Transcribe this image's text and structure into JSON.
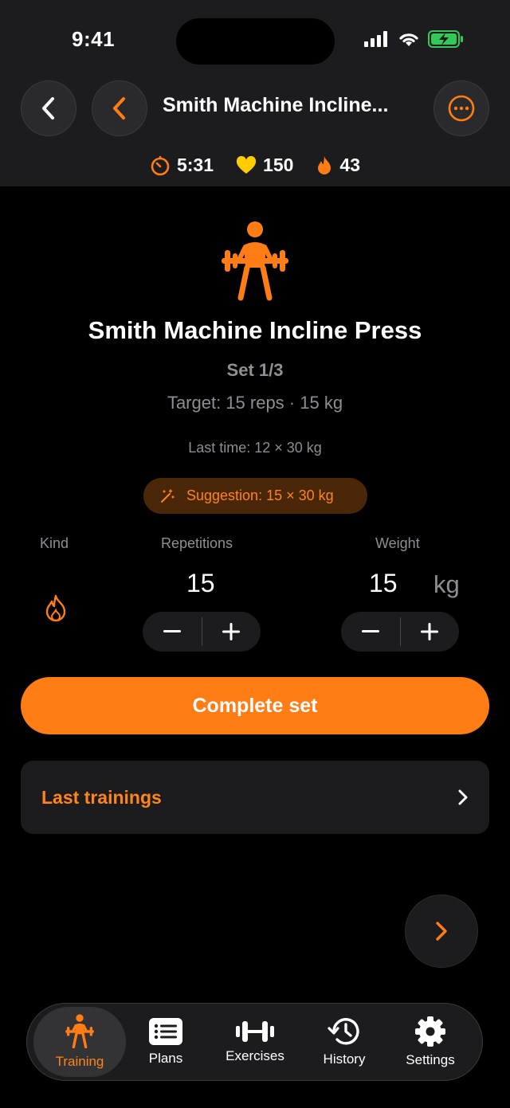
{
  "status_bar": {
    "time": "9:41"
  },
  "header": {
    "title": "Smith Machine Incline..."
  },
  "stats": {
    "timer": "5:31",
    "heart_rate": "150",
    "calories": "43"
  },
  "exercise": {
    "name": "Smith Machine Incline Press",
    "set_label": "Set 1/3",
    "target": "Target: 15 reps · 15 kg",
    "last_time": "Last time: 12 × 30 kg",
    "suggestion": "Suggestion: 15 × 30 kg"
  },
  "inputs": {
    "kind_label": "Kind",
    "reps_label": "Repetitions",
    "weight_label": "Weight",
    "reps_value": "15",
    "weight_value": "15",
    "weight_unit": "kg"
  },
  "actions": {
    "complete_set": "Complete set",
    "last_trainings": "Last trainings"
  },
  "tabs": [
    {
      "label": "Training",
      "icon": "weightlifter-icon",
      "active": true
    },
    {
      "label": "Plans",
      "icon": "list-icon",
      "active": false
    },
    {
      "label": "Exercises",
      "icon": "dumbbell-icon",
      "active": false
    },
    {
      "label": "History",
      "icon": "history-clock-icon",
      "active": false
    },
    {
      "label": "Settings",
      "icon": "gear-icon",
      "active": false
    }
  ],
  "colors": {
    "accent": "#ff7d14",
    "background": "#000000",
    "surface": "#1c1c1e",
    "muted": "#8e8e93",
    "heart": "#ffcc00"
  }
}
